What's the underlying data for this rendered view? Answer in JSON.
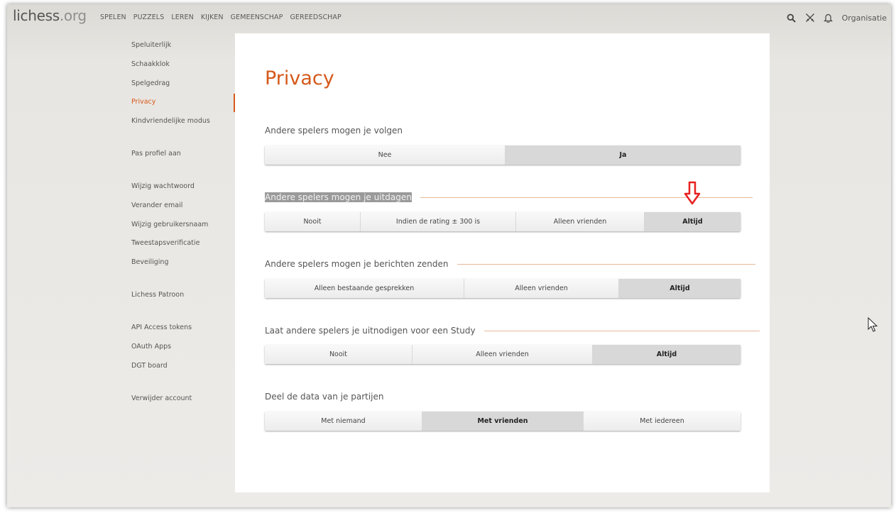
{
  "header": {
    "logo_main": "lichess",
    "logo_tld": ".org",
    "nav": [
      "SPELEN",
      "PUZZELS",
      "LEREN",
      "KIJKEN",
      "GEMEENSCHAP",
      "GEREEDSCHAP"
    ],
    "org_label": "Organisatie",
    "icons": [
      "search-icon",
      "crossed-swords-icon",
      "bell-icon"
    ]
  },
  "sidebar": {
    "items": [
      {
        "label": "Speluiterlijk"
      },
      {
        "label": "Schaakklok"
      },
      {
        "label": "Spelgedrag"
      },
      {
        "label": "Privacy",
        "active": true
      },
      {
        "label": "Kindvriendelijke modus"
      },
      {
        "label": "Pas profiel aan"
      },
      {
        "label": "Wijzig wachtwoord"
      },
      {
        "label": "Verander email"
      },
      {
        "label": "Wijzig gebruikersnaam"
      },
      {
        "label": "Tweestapsverificatie"
      },
      {
        "label": "Beveiliging"
      },
      {
        "label": "Lichess Patroon"
      },
      {
        "label": "API Access tokens"
      },
      {
        "label": "OAuth Apps"
      },
      {
        "label": "DGT board"
      },
      {
        "label": "Verwijder account"
      }
    ]
  },
  "main": {
    "title": "Privacy",
    "sections": [
      {
        "label": "Andere spelers mogen je volgen",
        "options": [
          "Nee",
          "Ja"
        ],
        "selected": 1
      },
      {
        "label": "Andere spelers mogen je uitdagen",
        "options": [
          "Nooit",
          "Indien de rating ± 300 is",
          "Alleen vrienden",
          "Altijd"
        ],
        "selected": 3,
        "highlighted": true
      },
      {
        "label": "Andere spelers mogen je berichten zenden",
        "options": [
          "Alleen bestaande gesprekken",
          "Alleen vrienden",
          "Altijd"
        ],
        "selected": 2
      },
      {
        "label": "Laat andere spelers je uitnodigen voor een Study",
        "options": [
          "Nooit",
          "Alleen vrienden",
          "Altijd"
        ],
        "selected": 2
      },
      {
        "label": "Deel de data van je partijen",
        "options": [
          "Met niemand",
          "Met vrienden",
          "Met iedereen"
        ],
        "selected": 1
      }
    ]
  },
  "colors": {
    "accent": "#d5591a",
    "annotation_arrow": "#e8201e"
  }
}
